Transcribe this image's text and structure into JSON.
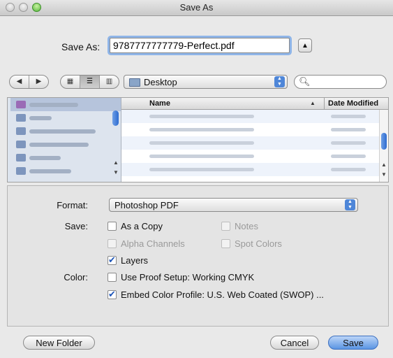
{
  "window": {
    "title": "Save As"
  },
  "saveas": {
    "label": "Save As:",
    "value": "9787777777779-Perfect.pdf"
  },
  "toolbar": {
    "location": "Desktop",
    "search_placeholder": ""
  },
  "columns": {
    "name": "Name",
    "date": "Date Modified"
  },
  "options": {
    "format_label": "Format:",
    "format_value": "Photoshop PDF",
    "save_label": "Save:",
    "color_label": "Color:",
    "as_a_copy": "As a Copy",
    "notes": "Notes",
    "alpha_channels": "Alpha Channels",
    "spot_colors": "Spot Colors",
    "layers": "Layers",
    "use_proof_setup": "Use Proof Setup:  Working CMYK",
    "embed_color_profile": "Embed Color Profile:  U.S. Web Coated (SWOP) ..."
  },
  "checkbox_states": {
    "as_a_copy": false,
    "notes": false,
    "alpha_channels": false,
    "spot_colors": false,
    "layers": true,
    "use_proof_setup": false,
    "embed_color_profile": true
  },
  "buttons": {
    "new_folder": "New Folder",
    "cancel": "Cancel",
    "save": "Save"
  },
  "colors": {
    "accent": "#4e86d8",
    "sidebar_bg": "#dde4ee",
    "selection": "#b6c4dc"
  }
}
